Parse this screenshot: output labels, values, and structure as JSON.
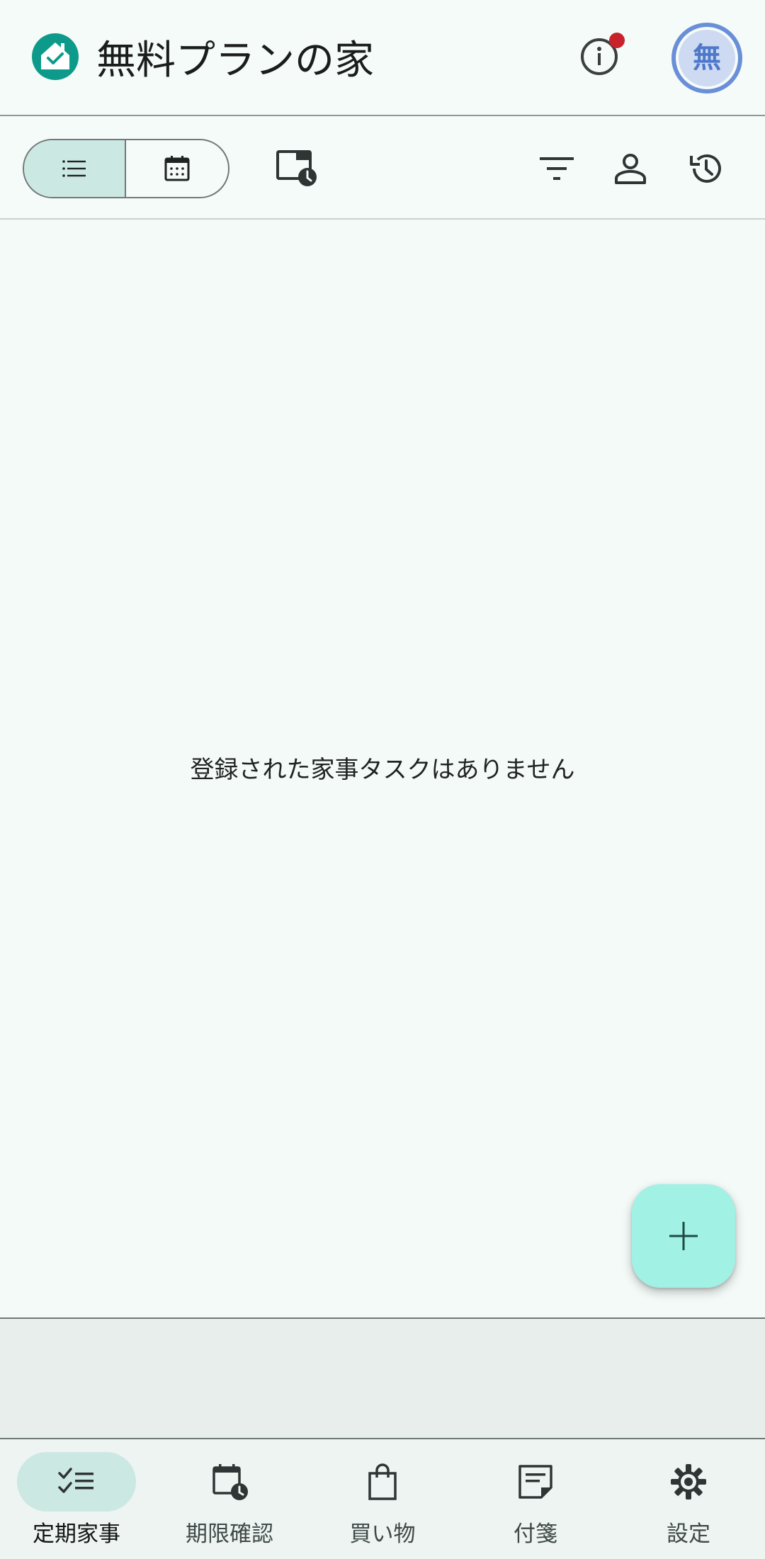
{
  "header": {
    "title": "無料プランの家",
    "logo_icon": "house-check-icon",
    "info_icon": "info-icon",
    "avatar_text": "無",
    "accent_color": "#009688"
  },
  "toolbar": {
    "view_toggle": [
      {
        "icon": "list-view-icon",
        "selected": true
      },
      {
        "icon": "calendar-view-icon",
        "selected": false
      }
    ],
    "actions": [
      {
        "icon": "schedule-window-icon"
      },
      {
        "icon": "filter-icon"
      },
      {
        "icon": "person-icon"
      },
      {
        "icon": "history-icon"
      }
    ]
  },
  "main": {
    "empty_message": "登録された家事タスクはありません"
  },
  "fab": {
    "icon": "plus-icon",
    "color": "#a1f1e4"
  },
  "bottom_nav": {
    "items": [
      {
        "label": "定期家事",
        "icon": "checklist-icon",
        "active": true
      },
      {
        "label": "期限確認",
        "icon": "calendar-clock-icon",
        "active": false
      },
      {
        "label": "買い物",
        "icon": "shopping-bag-icon",
        "active": false
      },
      {
        "label": "付箋",
        "icon": "sticky-note-icon",
        "active": false
      },
      {
        "label": "設定",
        "icon": "settings-gear-icon",
        "active": false
      }
    ]
  }
}
